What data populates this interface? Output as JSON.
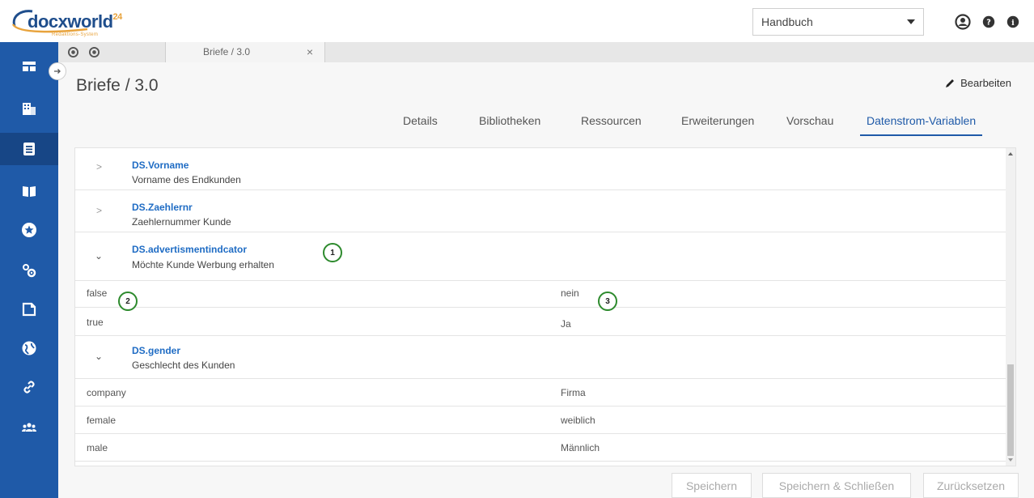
{
  "app": {
    "logo_text": "docxworld",
    "logo_sup": "24",
    "logo_sub": "Redaktions-System"
  },
  "header": {
    "doc_select_value": "Handbuch",
    "icons": [
      "user-icon",
      "help-icon",
      "info-icon"
    ]
  },
  "sidebar": {
    "items": [
      {
        "icon": "dashboard-icon"
      },
      {
        "icon": "building-icon"
      },
      {
        "icon": "document-icon",
        "active": true
      },
      {
        "icon": "book-icon"
      },
      {
        "icon": "star-icon"
      },
      {
        "icon": "gears-icon"
      },
      {
        "icon": "page-icon"
      },
      {
        "icon": "globe-icon"
      },
      {
        "icon": "link-icon"
      },
      {
        "icon": "users-icon"
      }
    ]
  },
  "tabbar": {
    "doc_tab_label": "Briefe / 3.0",
    "close": "×"
  },
  "main": {
    "title": "Briefe / 3.0",
    "edit_label": "Bearbeiten",
    "tabs": [
      {
        "label": "Details"
      },
      {
        "label": "Bibliotheken"
      },
      {
        "label": "Ressourcen"
      },
      {
        "label": "Erweiterungen"
      },
      {
        "label": "Vorschau"
      },
      {
        "label": "Datenstrom-Variablen",
        "active": true
      }
    ]
  },
  "variables": [
    {
      "name": "DS.Vorname",
      "desc": "Vorname des Endkunden",
      "expanded": false
    },
    {
      "name": "DS.Zaehlernr",
      "desc": "Zaehlernummer Kunde",
      "expanded": false
    },
    {
      "name": "DS.advertismentindcator",
      "desc": "Möchte Kunde Werbung erhalten",
      "expanded": true,
      "values": [
        {
          "key": "false",
          "value": "nein"
        },
        {
          "key": "true",
          "value": "Ja"
        }
      ]
    },
    {
      "name": "DS.gender",
      "desc": "Geschlecht des Kunden",
      "expanded": true,
      "values": [
        {
          "key": "company",
          "value": "Firma"
        },
        {
          "key": "female",
          "value": "weiblich"
        },
        {
          "key": "male",
          "value": "Männlich"
        }
      ]
    }
  ],
  "callouts": [
    "1",
    "2",
    "3"
  ],
  "footer": {
    "save": "Speichern",
    "save_close": "Speichern & Schließen",
    "reset": "Zurücksetzen"
  },
  "colors": {
    "brand_blue": "#1f5aa8",
    "link_blue": "#1f6cc4",
    "callout_green": "#2d8a2d",
    "logo_orange": "#e8a33c"
  }
}
